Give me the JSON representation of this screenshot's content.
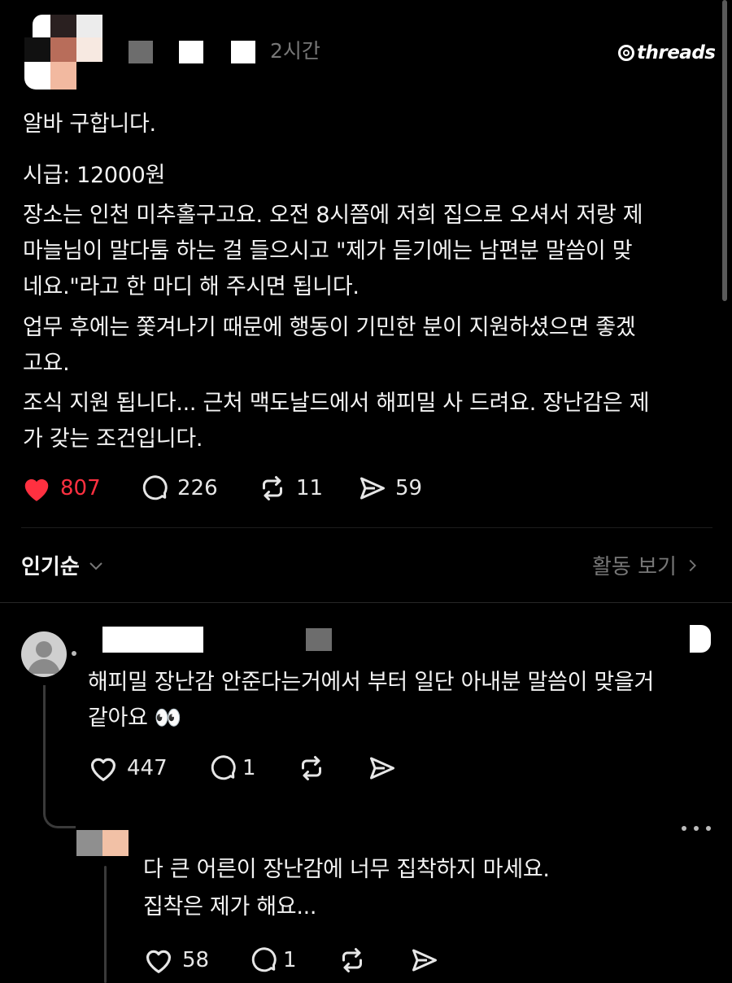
{
  "post": {
    "time": "2시간",
    "brand": "threads",
    "lines": [
      "알바 구합니다.",
      "시급: 12000원",
      "장소는 인천 미추홀구고요. 오전 8시쯤에 저희 집으로 오셔서 저랑 제",
      "마늘님이 말다툼 하는 걸 들으시고 \"제가 듣기에는 남편분 말씀이 맞",
      "네요.\"라고 한 마디 해 주시면 됩니다.",
      "업무 후에는 쫓겨나기 때문에 행동이 기민한 분이 지원하셨으면 좋겠",
      "고요.",
      "조식 지원 됩니다... 근처 맥도날드에서 해피밀 사 드려요. 장난감은 제",
      "가 갖는 조건입니다."
    ],
    "likes": "807",
    "comments": "226",
    "reposts": "11",
    "shares": "59",
    "like_color": "#ff3040"
  },
  "sort": {
    "label": "인기순",
    "activity_label": "활동 보기"
  },
  "reply1": {
    "lines": [
      "해피밀 장난감 안준다는거에서 부터 일단 아내분 말씀이 맞을거",
      "같아요 👀"
    ],
    "likes": "447",
    "comments": "1"
  },
  "reply2": {
    "lines": [
      "다 큰 어른이 장난감에 너무 집착하지 마세요.",
      "집착은 제가 해요..."
    ],
    "likes": "58",
    "comments": "1"
  }
}
